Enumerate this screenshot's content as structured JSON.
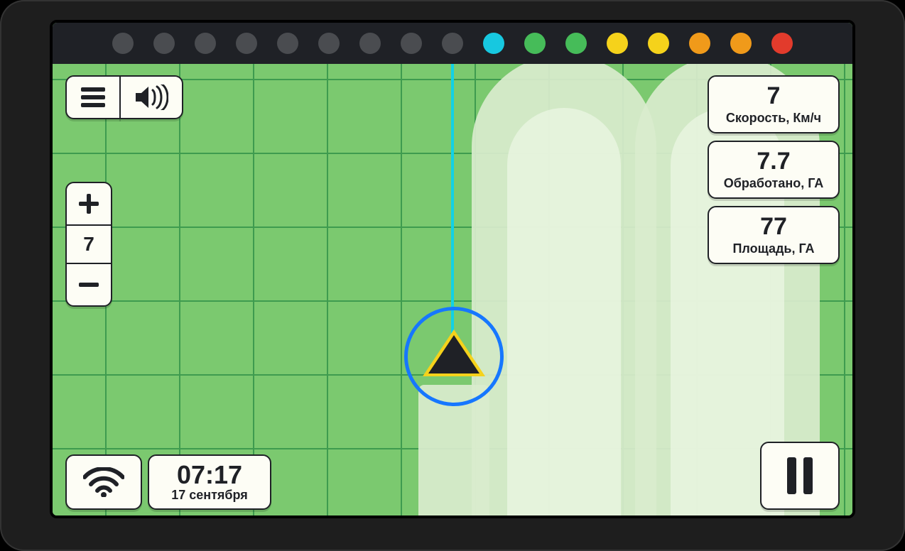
{
  "leds": [
    "off",
    "off",
    "off",
    "off",
    "off",
    "off",
    "off",
    "off",
    "off",
    "cyan",
    "green",
    "green",
    "yellow",
    "yellow",
    "orange",
    "orange",
    "red"
  ],
  "zoom": {
    "level": "7"
  },
  "time": {
    "clock": "07:17",
    "date": "17 сентября"
  },
  "metrics": {
    "speed": {
      "value": "7",
      "label": "Скорость, Км/ч"
    },
    "processed": {
      "value": "7.7",
      "label": "Обработано, ГА"
    },
    "area": {
      "value": "77",
      "label": "Площадь, ГА"
    }
  }
}
